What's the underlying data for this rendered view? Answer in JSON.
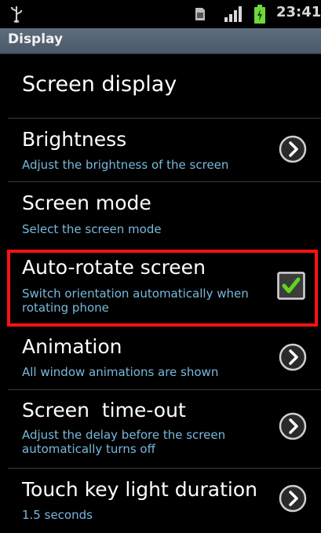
{
  "status_bar": {
    "time": "23:41",
    "icons": [
      "usb-icon",
      "sim-card-icon",
      "signal-icon",
      "battery-charging-icon"
    ]
  },
  "title_bar": {
    "title": "Display"
  },
  "section": {
    "header": "Screen display"
  },
  "items": [
    {
      "title": "Brightness",
      "subtitle": "Adjust the brightness of the screen",
      "control": "chevron-right-icon"
    },
    {
      "title": "Screen mode",
      "subtitle": "Select the screen mode",
      "control": "none"
    },
    {
      "title": "Auto-rotate screen",
      "subtitle": "Switch orientation automatically when rotating phone",
      "control": "checkbox",
      "checked": true,
      "highlighted": true
    },
    {
      "title": "Animation",
      "subtitle": "All window animations are shown",
      "control": "chevron-right-icon"
    },
    {
      "title": "Screen  time-out",
      "subtitle": "Adjust the delay before the screen automatically turns off",
      "control": "chevron-right-icon"
    },
    {
      "title": "Touch key light duration",
      "subtitle": "1.5 seconds",
      "control": "chevron-right-icon"
    }
  ],
  "colors": {
    "background": "#000000",
    "title_bar": "#556475",
    "subtitle": "#79b8dc",
    "highlight_border": "#ff1111",
    "checkmark": "#5fd61e"
  }
}
